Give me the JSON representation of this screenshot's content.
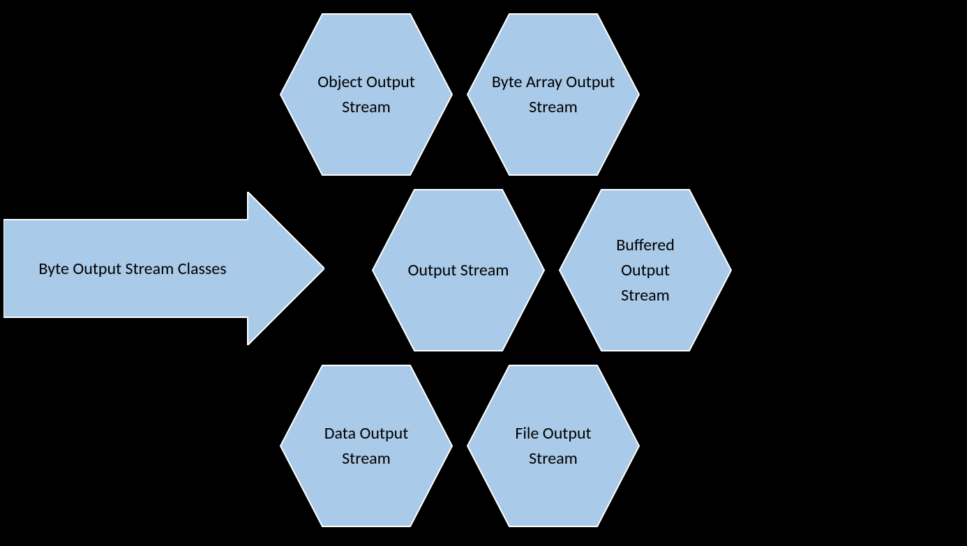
{
  "arrow": {
    "label": "Byte Output Stream Classes"
  },
  "hexagons": {
    "topLeft": "Object Output Stream",
    "topRight": "Byte Array Output\nStream",
    "center": "Output Stream",
    "right": "Buffered\nOutput\nStream",
    "botLeft": "Data Output\nStream",
    "botRight": "File Output\nStream"
  },
  "colors": {
    "shapeFill": "#a9cae8",
    "shapeStroke": "#ffffff",
    "background": "#000000"
  }
}
